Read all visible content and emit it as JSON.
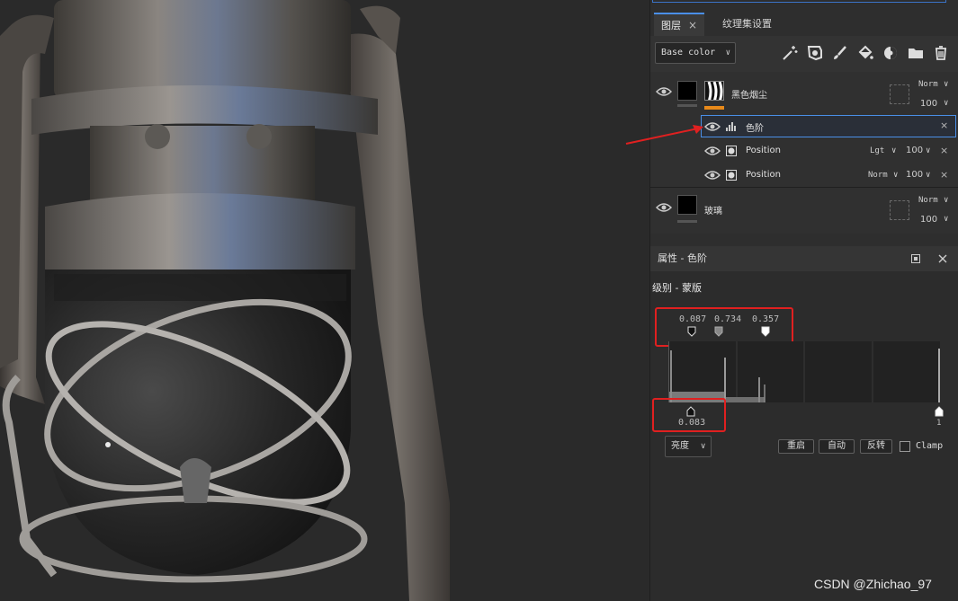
{
  "tabs": [
    {
      "label": "图层",
      "close": "×"
    },
    {
      "label": "纹理集设置"
    }
  ],
  "toolbar": {
    "channel_select": "Base color",
    "tools": [
      "magic-wand-icon",
      "fill-layer-icon",
      "paint-brush-icon",
      "fill-bucket-icon",
      "mask-icon",
      "folder-icon",
      "trash-icon"
    ]
  },
  "layers": [
    {
      "name": "黑色烟尘",
      "blend": "Norm",
      "opacity": "100"
    },
    {
      "name": "色阶",
      "close": "×"
    },
    {
      "name": "Position",
      "blend": "Lgt",
      "opacity": "100",
      "close": "×"
    },
    {
      "name": "Position",
      "blend": "Norm",
      "opacity": "100",
      "close": "×"
    },
    {
      "name": "玻璃",
      "blend": "Norm",
      "opacity": "100"
    }
  ],
  "properties": {
    "title": "属性 - 色阶",
    "section": "级别 - 蒙版",
    "top_values": {
      "a": "0.087",
      "b": "0.734",
      "c": "0.357"
    },
    "input_low": "0.083",
    "input_high": "1",
    "mode_select": "亮度",
    "buttons": {
      "reset": "重启",
      "auto": "自动",
      "invert": "反转"
    },
    "clamp_label": "Clamp"
  },
  "watermark": "CSDN @Zhichao_97",
  "colors": {
    "accent": "#4a8fe8",
    "highlight_red": "#e02020",
    "orange_bar": "#e88a1a"
  }
}
